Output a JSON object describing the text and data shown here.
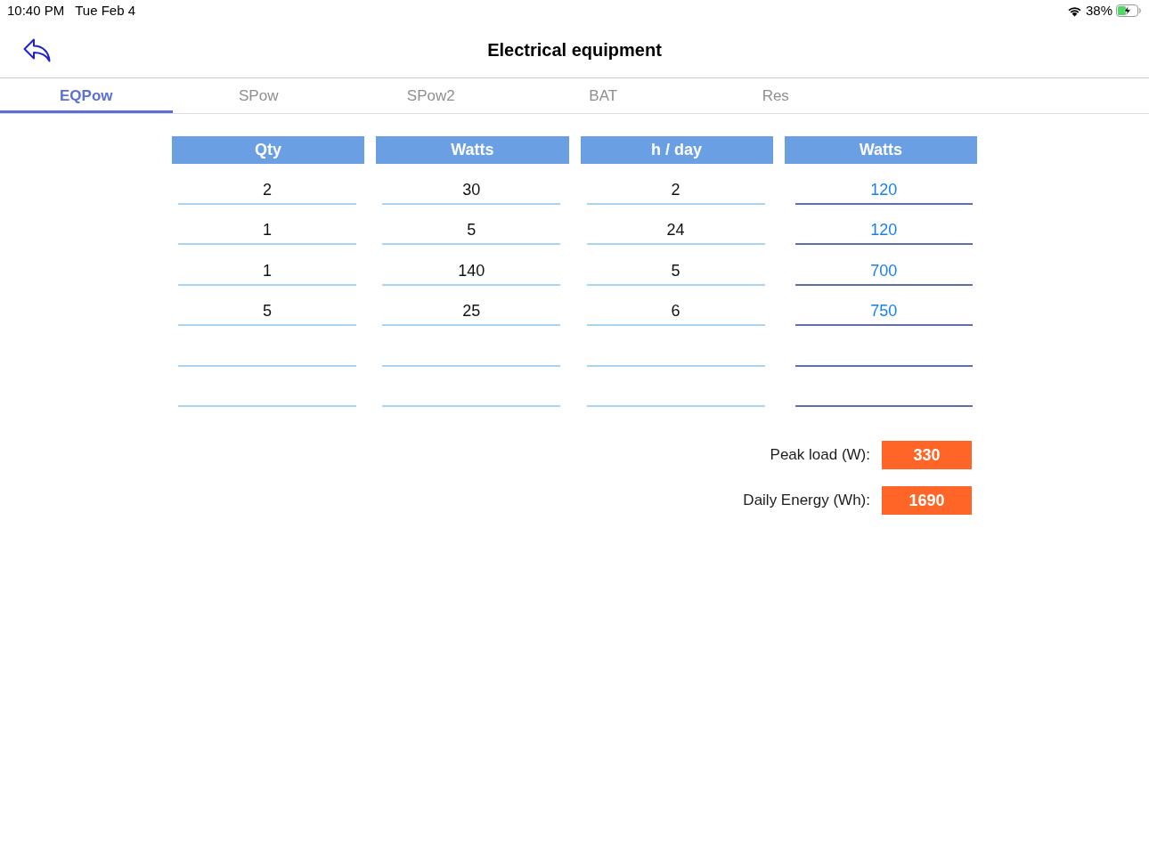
{
  "status_bar": {
    "time": "10:40 PM",
    "date": "Tue Feb 4",
    "battery": "38%",
    "charging": true
  },
  "nav": {
    "title": "Electrical equipment"
  },
  "tabs": [
    {
      "label": "EQPow",
      "selected": true
    },
    {
      "label": "SPow",
      "selected": false
    },
    {
      "label": "SPow2",
      "selected": false
    },
    {
      "label": "BAT",
      "selected": false
    },
    {
      "label": "Res",
      "selected": false
    }
  ],
  "table": {
    "columns": [
      {
        "label": "Qty",
        "kind": "input"
      },
      {
        "label": "Watts",
        "kind": "input"
      },
      {
        "label": "h / day",
        "kind": "input"
      },
      {
        "label": "Watts",
        "kind": "result"
      }
    ],
    "rows": [
      {
        "kind": "filled",
        "cells": [
          "2",
          "30",
          "2",
          "120"
        ]
      },
      {
        "kind": "filled",
        "cells": [
          "1",
          "5",
          "24",
          "120"
        ]
      },
      {
        "kind": "filled",
        "cells": [
          "1",
          "140",
          "5",
          "700"
        ]
      },
      {
        "kind": "filled",
        "cells": [
          "5",
          "25",
          "6",
          "750"
        ]
      },
      {
        "kind": "blank"
      },
      {
        "kind": "blank"
      }
    ]
  },
  "totals": [
    {
      "label": "Peak load (W):",
      "value": "330"
    },
    {
      "label": "Daily Energy (Wh):",
      "value": "1690"
    }
  ]
}
